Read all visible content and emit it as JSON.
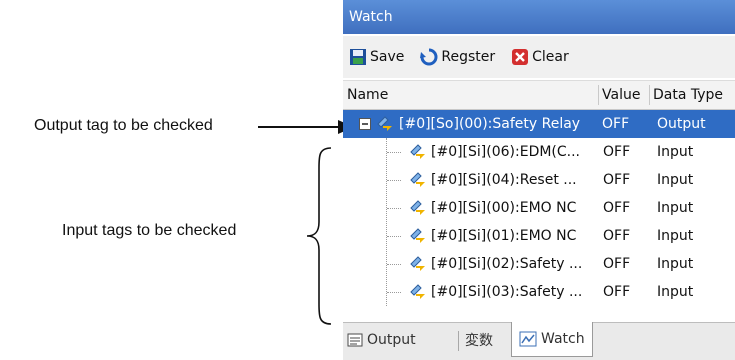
{
  "annotations": {
    "output_label": "Output tag to be checked",
    "input_label": "Input tags to be checked"
  },
  "window": {
    "title": "Watch"
  },
  "toolbar": {
    "save": "Save",
    "register": "Regster",
    "clear": "Clear"
  },
  "columns": {
    "name": "Name",
    "value": "Value",
    "type": "Data Type"
  },
  "rows": [
    {
      "name": "[#0][So](00):Safety Relay",
      "value": "OFF",
      "type": "Output"
    },
    {
      "name": "[#0][Si](06):EDM(C...",
      "value": "OFF",
      "type": "Input"
    },
    {
      "name": "[#0][Si](04):Reset ...",
      "value": "OFF",
      "type": "Input"
    },
    {
      "name": "[#0][Si](00):EMO NC",
      "value": "OFF",
      "type": "Input"
    },
    {
      "name": "[#0][Si](01):EMO NC",
      "value": "OFF",
      "type": "Input"
    },
    {
      "name": "[#0][Si](02):Safety ...",
      "value": "OFF",
      "type": "Input"
    },
    {
      "name": "[#0][Si](03):Safety ...",
      "value": "OFF",
      "type": "Input"
    }
  ],
  "tabs": {
    "output": "Output",
    "vars": "変数",
    "watch": "Watch"
  },
  "colors": {
    "title_bar": "#3f6fbf",
    "selection": "#2f6cc4",
    "clear_icon": "#d32f2f"
  }
}
